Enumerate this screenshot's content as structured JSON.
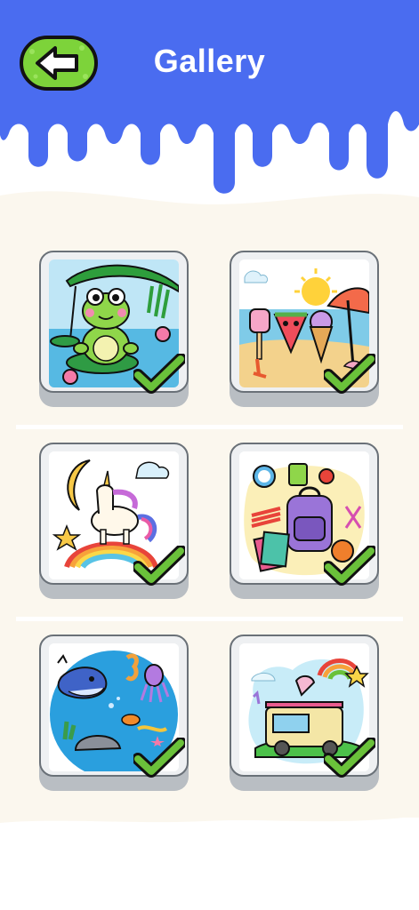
{
  "header": {
    "title": "Gallery",
    "back_icon": "back-arrow-icon",
    "colors": {
      "header_blue": "#4a6cf0",
      "back_green": "#7dd33a",
      "check_green": "#6ac13a"
    }
  },
  "gallery": {
    "items": [
      {
        "name": "frog-pond",
        "completed": true
      },
      {
        "name": "summer-beach",
        "completed": true
      },
      {
        "name": "unicorn-rainbow",
        "completed": true
      },
      {
        "name": "school-supplies",
        "completed": true
      },
      {
        "name": "ocean-life",
        "completed": true
      },
      {
        "name": "ice-cream-truck",
        "completed": true
      }
    ]
  }
}
